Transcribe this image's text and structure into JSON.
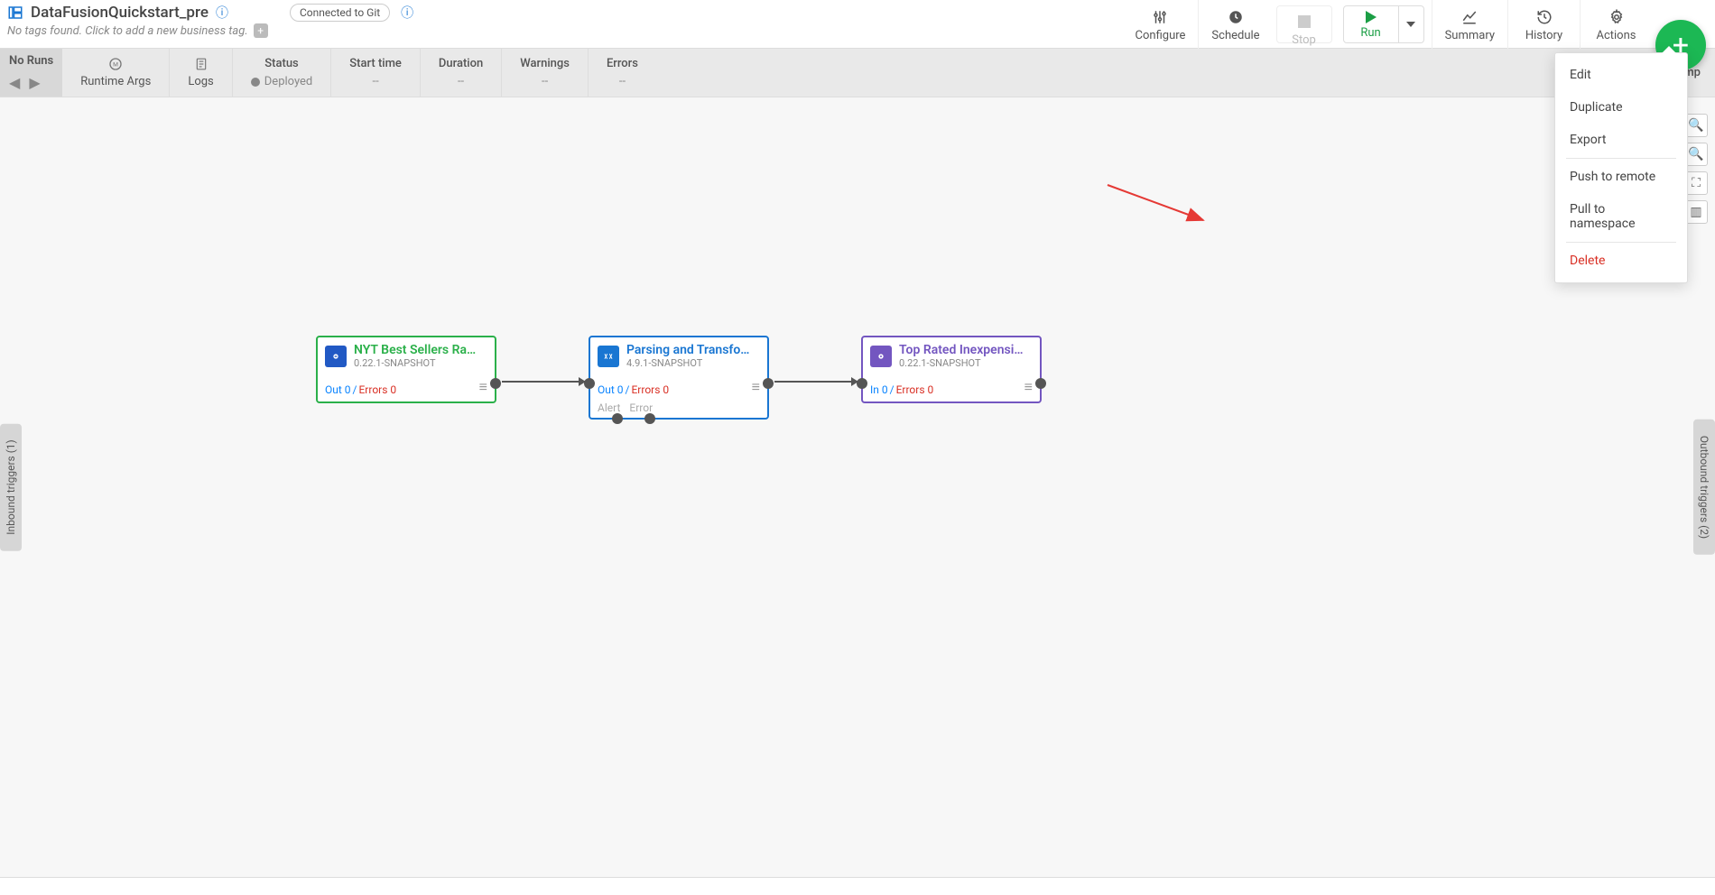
{
  "header": {
    "title": "DataFusionQuickstart_pre",
    "git_status": "Connected to Git",
    "tags_text": "No tags found. Click to add a new business tag."
  },
  "toolbar": {
    "configure": "Configure",
    "schedule": "Schedule",
    "stop": "Stop",
    "run": "Run",
    "summary": "Summary",
    "history": "History",
    "actions": "Actions"
  },
  "subheader": {
    "noruns": "No Runs",
    "runtime_args": "Runtime Args",
    "logs": "Logs",
    "status_label": "Status",
    "status_value": "Deployed",
    "start_time_label": "Start time",
    "start_time_value": "--",
    "duration_label": "Duration",
    "duration_value": "--",
    "warnings_label": "Warnings",
    "warnings_value": "--",
    "errors_label": "Errors",
    "errors_value": "--",
    "compute": "Comp"
  },
  "nodes": {
    "n1": {
      "title": "NYT Best Sellers Ra…",
      "version": "0.22.1-SNAPSHOT",
      "out_label": "Out 0",
      "slash": " / ",
      "err_label": "Errors 0"
    },
    "n2": {
      "title": "Parsing and Transfo…",
      "version": "4.9.1-SNAPSHOT",
      "out_label": "Out 0",
      "slash": " / ",
      "err_label": "Errors 0",
      "alert": "Alert",
      "error": "Error"
    },
    "n3": {
      "title": "Top Rated Inexpensi…",
      "version": "0.22.1-SNAPSHOT",
      "in_label": "In 0",
      "slash": " / ",
      "err_label": "Errors 0"
    }
  },
  "side": {
    "inbound": "Inbound triggers (1)",
    "outbound": "Outbound triggers (2)"
  },
  "menu": {
    "edit": "Edit",
    "duplicate": "Duplicate",
    "export": "Export",
    "push": "Push to remote",
    "pull": "Pull to namespace",
    "delete": "Delete"
  }
}
